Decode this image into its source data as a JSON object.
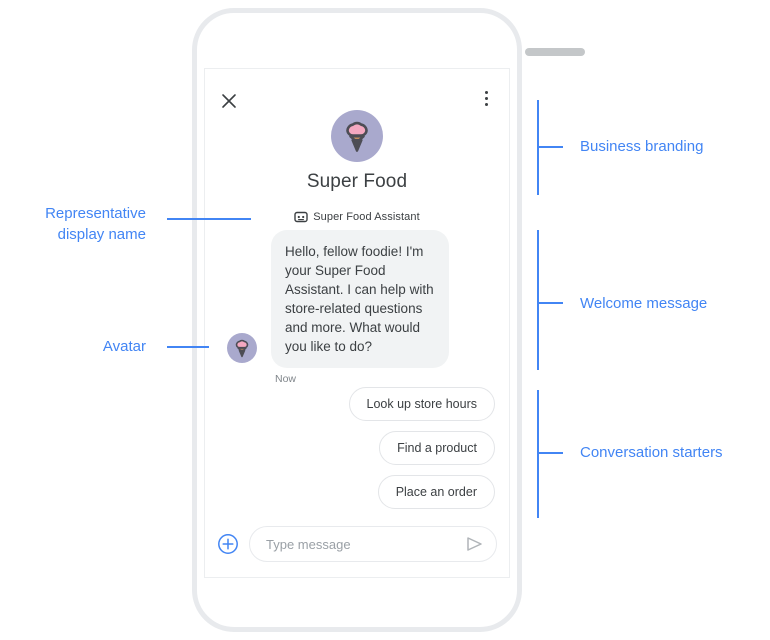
{
  "phone": {
    "speaker_grille": "speaker-grille"
  },
  "chat": {
    "header": {
      "close_label": "close",
      "menu_label": "more options"
    },
    "branding": {
      "logo_alt": "ice-cream-cone-logo",
      "business_name": "Super Food"
    },
    "representative": {
      "icon_alt": "bot-icon",
      "display_name": "Super Food Assistant"
    },
    "welcome": {
      "avatar_alt": "ice-cream-cone-avatar",
      "text": "Hello, fellow foodie! I'm your Super Food Assistant. I can help with store-related questions and more. What would you like to do?",
      "timestamp": "Now"
    },
    "starters": [
      {
        "label": "Look up store hours"
      },
      {
        "label": "Find a product"
      },
      {
        "label": "Place an order"
      }
    ],
    "composer": {
      "add_label": "add attachment",
      "placeholder": "Type message",
      "value": "",
      "send_label": "send"
    }
  },
  "annotations": {
    "left": [
      {
        "text": "Representative\ndisplay name"
      },
      {
        "text": "Avatar"
      }
    ],
    "right": [
      {
        "text": "Business branding"
      },
      {
        "text": "Welcome message"
      },
      {
        "text": "Conversation starters"
      }
    ]
  },
  "colors": {
    "accent": "#4285f4",
    "bubble_bg": "#f1f3f4",
    "text_primary": "#3c4043",
    "text_secondary": "#80868b",
    "frame": "#e8eaed",
    "logo_circle": "#a9a9cd",
    "logo_scoop": "#f4a8c0",
    "logo_cone": "#c08b5c",
    "logo_outline": "#4d4d55"
  }
}
